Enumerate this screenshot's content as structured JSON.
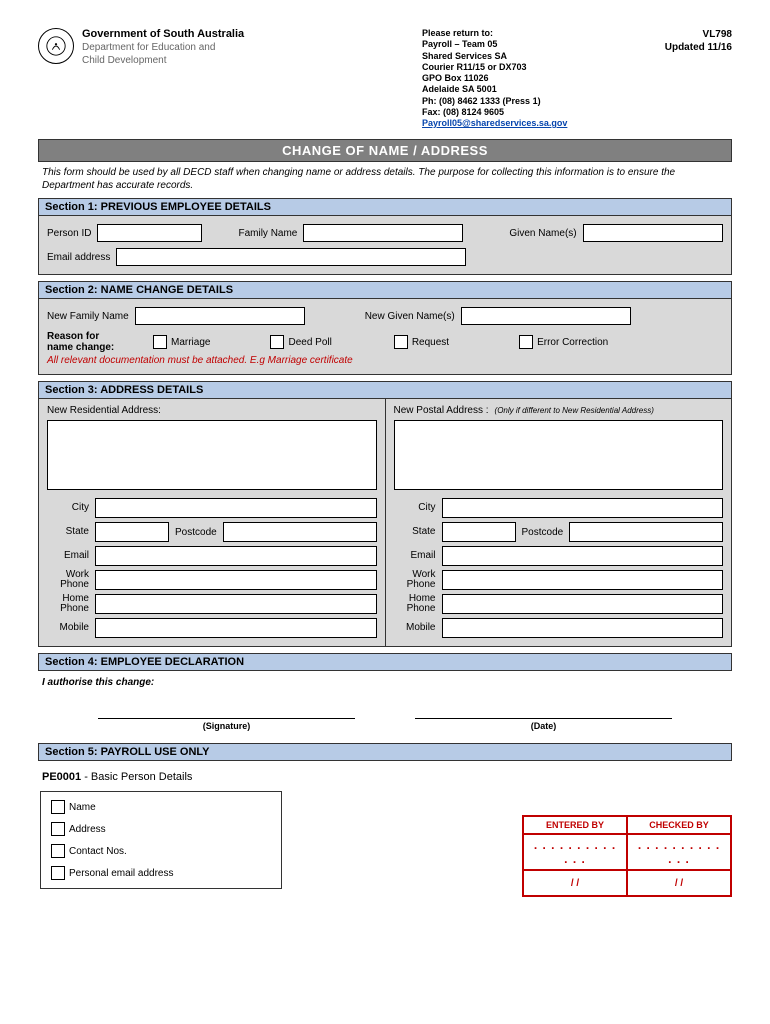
{
  "header": {
    "gov_title": "Government of South Australia",
    "dept_line1": "Department for Education and",
    "dept_line2": "Child Development",
    "return": {
      "line1": "Please return to:",
      "line2": "Payroll – Team 05",
      "line3": "Shared Services SA",
      "line4": "Courier R11/15 or DX703",
      "line5": "GPO Box 11026",
      "line6": "Adelaide SA 5001",
      "line7": "Ph: (08) 8462 1333 (Press 1)",
      "line8": "Fax: (08) 8124 9605",
      "email": "Payroll05@sharedservices.sa.gov"
    },
    "code": "VL798",
    "updated": "Updated 11/16"
  },
  "title": "CHANGE OF NAME / ADDRESS",
  "intro": "This form should be used by all DECD staff when changing name or address details. The purpose for collecting this information is to ensure the Department has accurate records.",
  "s1": {
    "head": "Section 1: PREVIOUS EMPLOYEE DETAILS",
    "person_id": "Person ID",
    "family_name": "Family Name",
    "given_names": "Given Name(s)",
    "email": "Email address"
  },
  "s2": {
    "head": "Section 2: NAME CHANGE DETAILS",
    "new_family": "New Family Name",
    "new_given": "New Given Name(s)",
    "reason_lbl1": "Reason for",
    "reason_lbl2": "name change:",
    "opt_marriage": "Marriage",
    "opt_deed": "Deed Poll",
    "opt_request": "Request",
    "opt_error": "Error Correction",
    "note": "All relevant documentation must be attached. E.g Marriage certificate"
  },
  "s3": {
    "head": "Section 3: ADDRESS DETAILS",
    "res_title": "New Residential Address:",
    "post_title": "New Postal Address :",
    "post_sub": "(Only if different to New Residential Address)",
    "city": "City",
    "state": "State",
    "postcode": "Postcode",
    "email": "Email",
    "work_phone1": "Work",
    "work_phone2": "Phone",
    "home_phone1": "Home",
    "home_phone2": "Phone",
    "mobile": "Mobile"
  },
  "s4": {
    "head": "Section 4: EMPLOYEE DECLARATION",
    "decl": "I authorise this change:",
    "signature": "(Signature)",
    "date": "(Date)"
  },
  "s5": {
    "head": "Section 5: PAYROLL USE ONLY",
    "pe_code": "PE0001",
    "pe_desc": " - Basic Person Details",
    "name": "Name",
    "address": "Address",
    "contact": "Contact Nos.",
    "email": "Personal email address",
    "entered": "ENTERED BY",
    "checked": "CHECKED BY",
    "dots": ". . . . . . . . . . . . .",
    "date_blank": "/     /"
  }
}
